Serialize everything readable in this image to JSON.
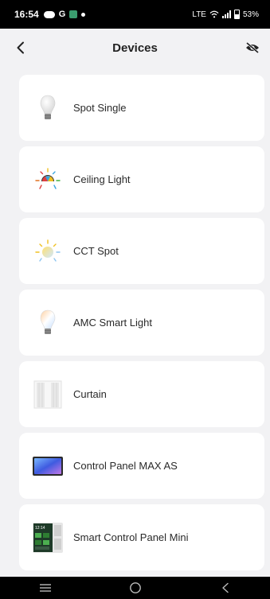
{
  "status_bar": {
    "time": "16:54",
    "battery": "53%",
    "network": "LTE"
  },
  "header": {
    "title": "Devices",
    "back_icon": "chevron-left-icon",
    "hide_icon": "eye-off-icon"
  },
  "devices": [
    {
      "label": "Spot Single",
      "icon": "bulb-icon"
    },
    {
      "label": "Ceiling Light",
      "icon": "ceiling-light-icon"
    },
    {
      "label": "CCT Spot",
      "icon": "cct-spot-icon"
    },
    {
      "label": "AMC Smart Light",
      "icon": "smart-bulb-icon"
    },
    {
      "label": "Curtain",
      "icon": "curtain-icon"
    },
    {
      "label": "Control Panel MAX AS",
      "icon": "control-panel-icon"
    },
    {
      "label": "Smart Control Panel Mini",
      "icon": "panel-mini-icon"
    }
  ],
  "panel_mini_screen_time": "12:14",
  "colors": {
    "background": "#f2f2f4",
    "card": "#ffffff",
    "statusbar": "#000000"
  }
}
